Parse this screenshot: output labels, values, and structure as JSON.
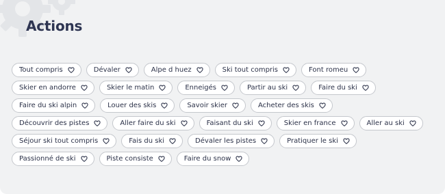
{
  "title": "Actions",
  "colors": {
    "heading": "#2e3552",
    "tag_border": "#c4c7cc",
    "panel_bg": "#f1f2f3"
  },
  "tag_icon": "heart-icon",
  "tags": [
    "Tout compris",
    "Dévaler",
    "Alpe d huez",
    "Ski tout compris",
    "Font romeu",
    "Skier en andorre",
    "Skier le matin",
    "Enneigés",
    "Partir au ski",
    "Faire du ski",
    "Faire du ski alpin",
    "Louer des skis",
    "Savoir skier",
    "Acheter des skis",
    "Découvrir des pistes",
    "Aller faire du ski",
    "Faisant du ski",
    "Skier en france",
    "Aller au ski",
    "Séjour ski tout compris",
    "Fais du ski",
    "Dévaler les pistes",
    "Pratiquer le ski",
    "Passionné de ski",
    "Piste consiste",
    "Faire du snow"
  ]
}
